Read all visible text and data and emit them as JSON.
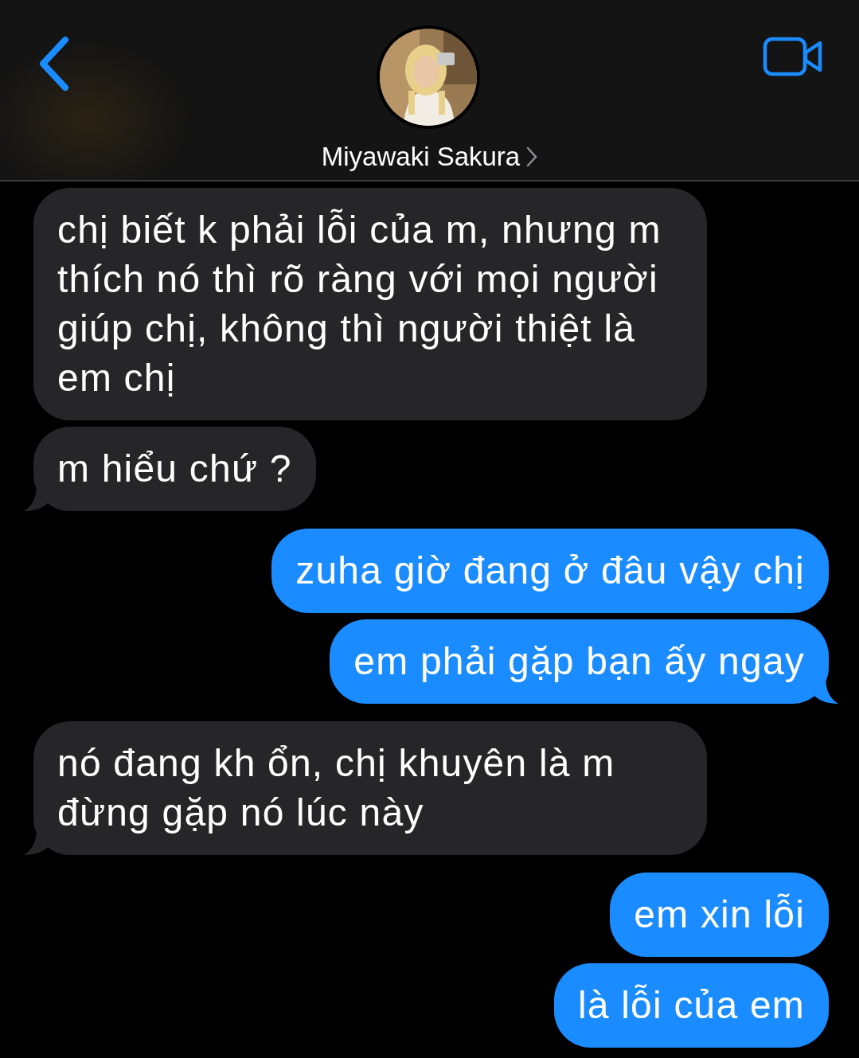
{
  "header": {
    "contact_name": "Miyawaki Sakura"
  },
  "messages": [
    {
      "text": "chị biết k phải lỗi của m, nhưng m thích nó thì rõ ràng với mọi người giúp chị, không thì người thiệt là em chị",
      "kind": "received",
      "tail": false
    },
    {
      "text": "m hiểu chứ ?",
      "kind": "received",
      "tail": true
    },
    {
      "text": "zuha giờ đang ở đâu vậy chị",
      "kind": "sent",
      "tail": false
    },
    {
      "text": "em phải gặp bạn ấy ngay",
      "kind": "sent",
      "tail": true
    },
    {
      "text": "nó đang kh ổn, chị khuyên là m đừng gặp nó lúc này",
      "kind": "received",
      "tail": true
    },
    {
      "text": "em xin lỗi",
      "kind": "sent",
      "tail": false
    },
    {
      "text": "là lỗi của em",
      "kind": "sent",
      "tail": false
    }
  ]
}
